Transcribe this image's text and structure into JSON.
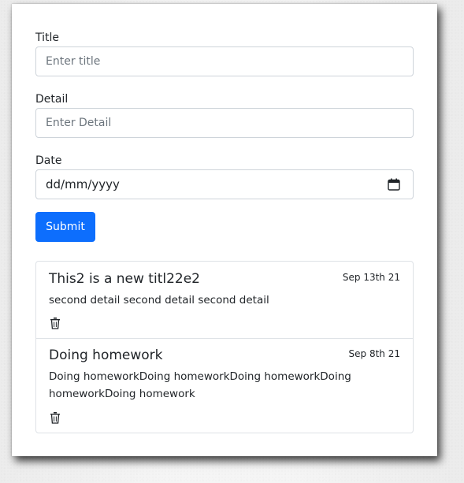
{
  "form": {
    "title_label": "Title",
    "title_placeholder": "Enter title",
    "detail_label": "Detail",
    "detail_placeholder": "Enter Detail",
    "date_label": "Date",
    "date_value": "dd/mm/yyyy",
    "submit_label": "Submit"
  },
  "todos": [
    {
      "title": "This2 is a new titl22e2",
      "date": "Sep 13th 21",
      "detail": "second detail second detail second detail",
      "icon": "trash-icon"
    },
    {
      "title": "Doing homework",
      "date": "Sep 8th 21",
      "detail": "Doing homeworkDoing homeworkDoing homeworkDoing homeworkDoing homework",
      "icon": "trash-icon"
    }
  ],
  "colors": {
    "primary": "#0d6efd",
    "border": "#ced4da",
    "text": "#212529"
  }
}
